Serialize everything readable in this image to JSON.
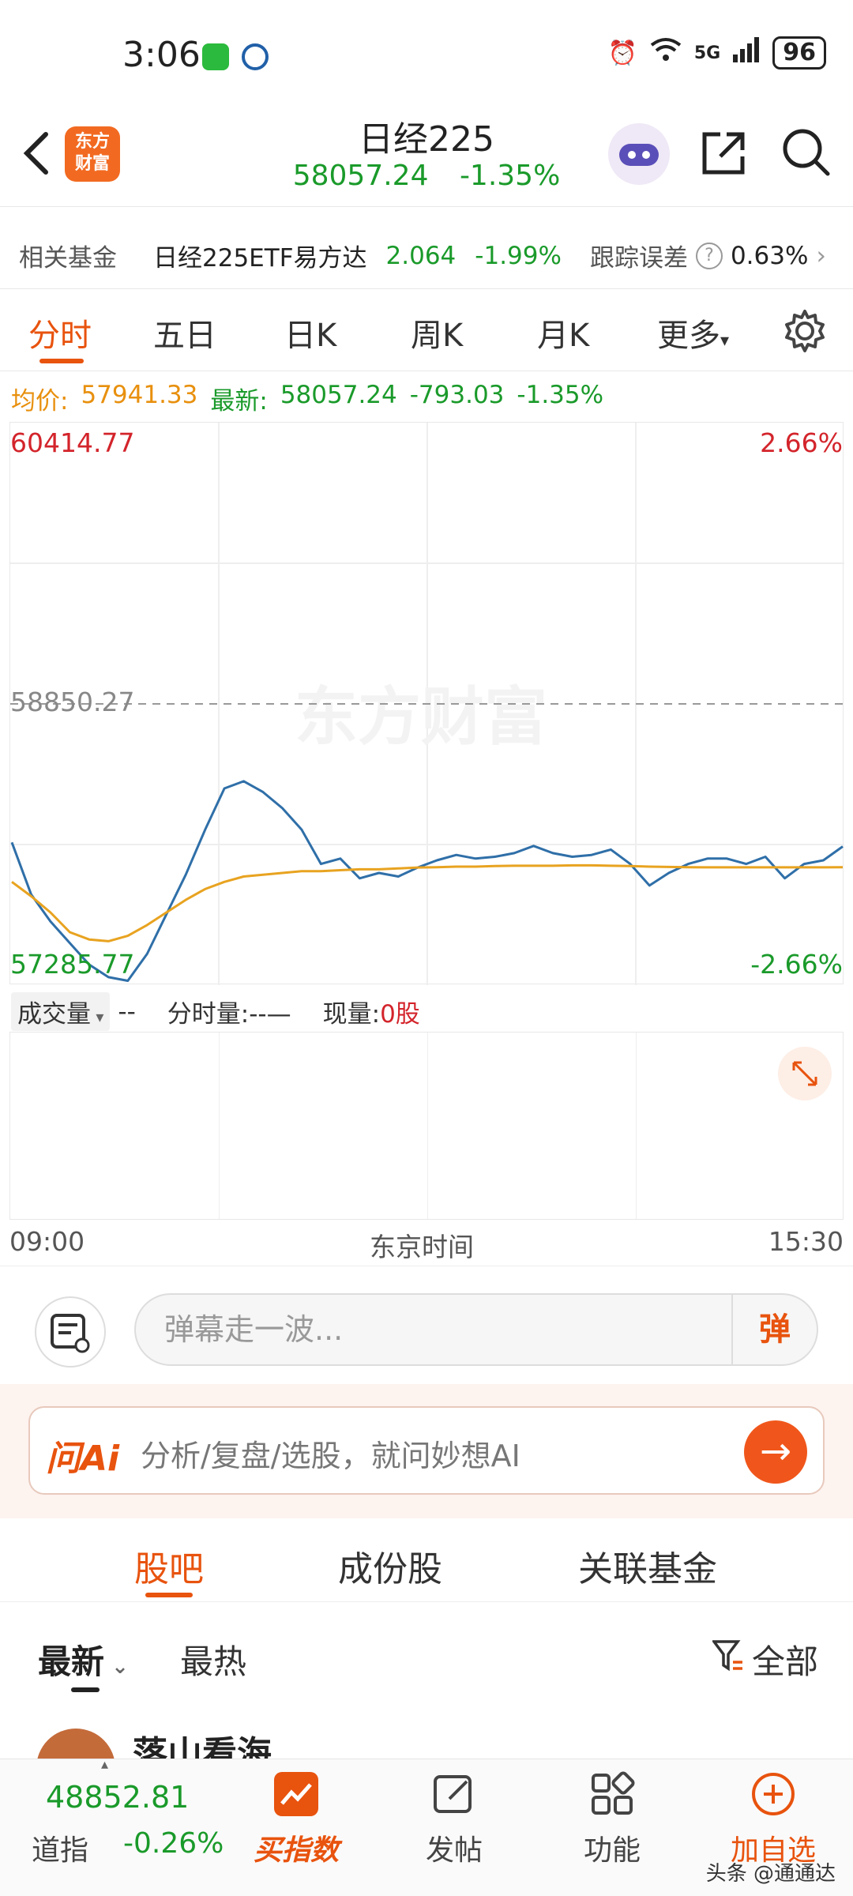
{
  "status_bar": {
    "time": "3:06",
    "network": "5G",
    "battery": "96"
  },
  "header": {
    "logo_text": "东方\n财富",
    "title": "日经225",
    "price": "58057.24",
    "change_pct": "-1.35%"
  },
  "fund_bar": {
    "label": "相关基金",
    "fund_name": "日经225ETF易方达",
    "fund_price": "2.064",
    "fund_change": "-1.99%",
    "tracking_label": "跟踪误差",
    "tracking_value": "0.63%"
  },
  "tabs": [
    "分时",
    "五日",
    "日K",
    "周K",
    "月K",
    "更多"
  ],
  "info_line": {
    "avg_label": "均价:",
    "avg_value": "57941.33",
    "latest_label": "最新:",
    "latest_value": "58057.24",
    "change": "-793.03",
    "change_pct": "-1.35%"
  },
  "chart_data": {
    "type": "line",
    "y_high": "60414.77",
    "y_mid": "58850.27",
    "y_low": "57285.77",
    "pct_high": "2.66%",
    "pct_low": "-2.66%",
    "ylim": [
      57285.77,
      60414.77
    ],
    "x_start": "09:00",
    "x_end": "15:30",
    "x_label": "东京时间",
    "watermark": "东方财富",
    "series": [
      {
        "values": [
          58080,
          57790,
          57640,
          57520,
          57400,
          57330,
          57310,
          57460,
          57680,
          57900,
          58150,
          58380,
          58420,
          58360,
          58270,
          58150,
          57960,
          57990,
          57880,
          57910,
          57890,
          57940,
          57980,
          58010,
          57990,
          58000,
          58020,
          58060,
          58020,
          58000,
          58010,
          58040,
          57960,
          57840,
          57910,
          57960,
          57990,
          57990,
          57960,
          58000,
          57880,
          57960,
          57980,
          58057.24
        ],
        "color": "#2f6fa8"
      },
      {
        "values": [
          57860,
          57780,
          57690,
          57580,
          57540,
          57530,
          57560,
          57620,
          57690,
          57760,
          57820,
          57860,
          57890,
          57900,
          57910,
          57920,
          57920,
          57925,
          57930,
          57930,
          57935,
          57940,
          57942,
          57945,
          57945,
          57948,
          57950,
          57950,
          57950,
          57952,
          57952,
          57950,
          57948,
          57945,
          57943,
          57942,
          57941,
          57941,
          57941,
          57941,
          57941,
          57941,
          57941,
          57941.33
        ],
        "color": "#e8a320"
      }
    ]
  },
  "volume": {
    "label": "成交量",
    "label_suffix": "--",
    "tick_label": "分时量:",
    "tick_value": "--—",
    "now_label": "现量:",
    "now_value": "0股"
  },
  "danmu": {
    "placeholder": "弹幕走一波...",
    "button": "弹"
  },
  "ai": {
    "logo": "问Ai",
    "prompt": "分析/复盘/选股，就问妙想AI"
  },
  "sub_tabs": [
    "股吧",
    "成份股",
    "关联基金"
  ],
  "sort": {
    "latest": "最新",
    "hot": "最热",
    "filter": "全部"
  },
  "post": {
    "user": "落山看海"
  },
  "bottom": {
    "dow_value": "48852.81",
    "dow_name": "道指",
    "dow_change": "-0.26%",
    "nav": [
      "买指数",
      "发帖",
      "功能",
      "加自选"
    ],
    "watermark": "头条 @通通达"
  }
}
